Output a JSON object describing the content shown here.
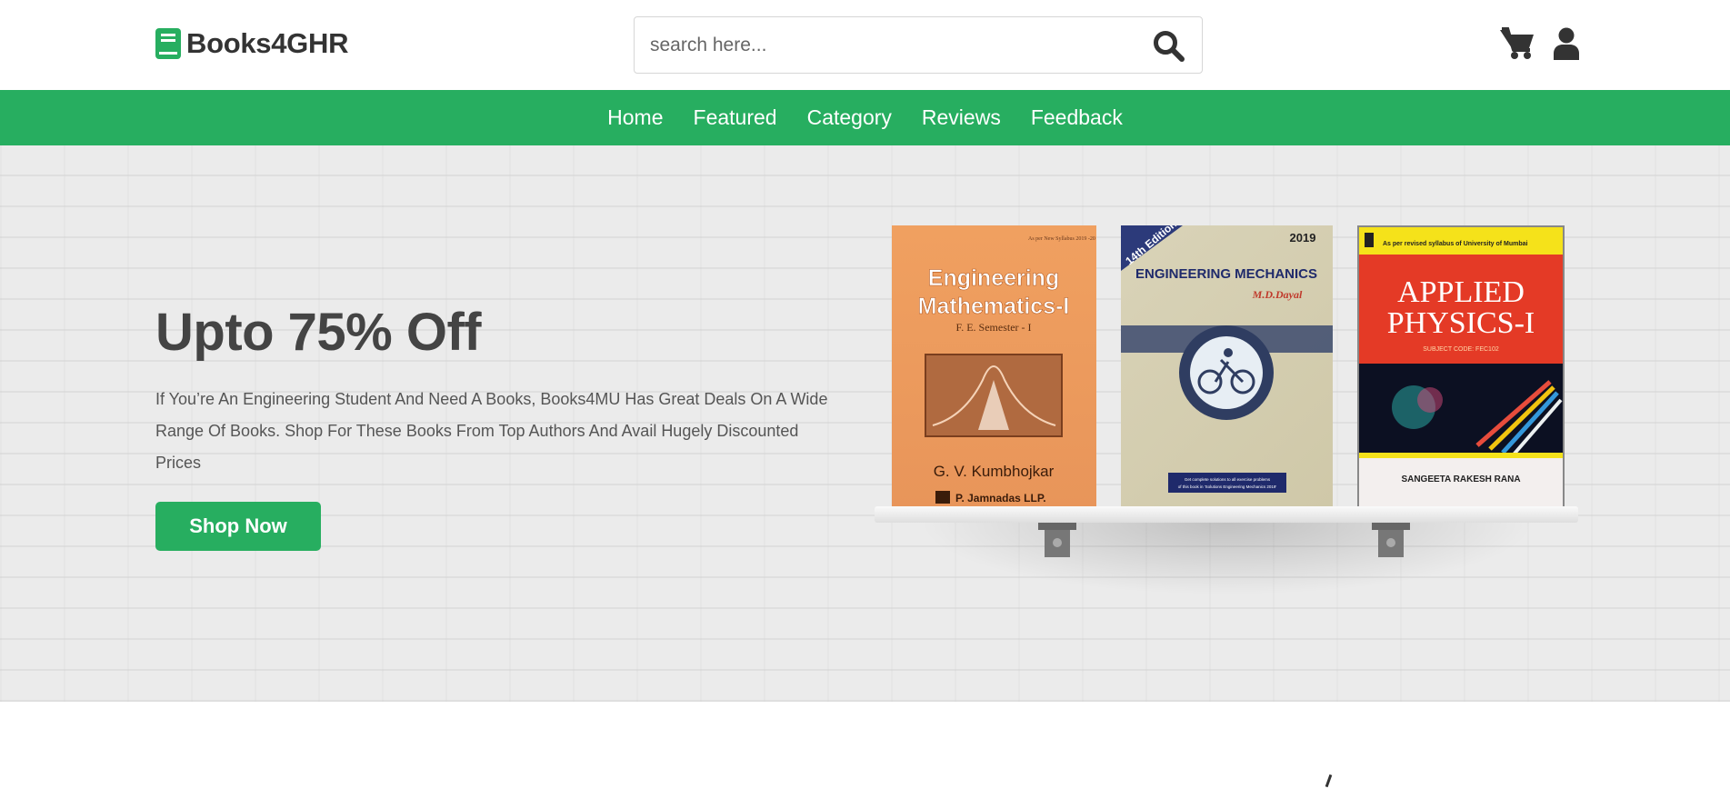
{
  "header": {
    "logo_text": "Books4GHR",
    "logo_icon": "book-icon",
    "search": {
      "placeholder": "search here...",
      "value": ""
    },
    "search_icon": "search-icon",
    "cart_icon": "shopping-cart-icon",
    "user_icon": "user-icon"
  },
  "nav": {
    "items": [
      {
        "label": "Home"
      },
      {
        "label": "Featured"
      },
      {
        "label": "Category"
      },
      {
        "label": "Reviews"
      },
      {
        "label": "Feedback"
      }
    ]
  },
  "hero": {
    "title": "Upto 75% Off",
    "description": "If You’re An Engineering Student And Need A Books, Books4MU Has Great Deals On A Wide Range Of Books. Shop For These Books From Top Authors And Avail Hugely Discounted Prices",
    "button_label": "Shop Now",
    "books": [
      {
        "title": "Engineering Mathematics-I",
        "subtitle": "F. E. Semester - I",
        "top_note": "As per New Syllabus 2019 -20",
        "author": "G. V. Kumbhojkar",
        "publisher": "P. Jamnadas LLP."
      },
      {
        "title": "ENGINEERING MECHANICS",
        "author": "M.D.Dayal",
        "edition": "14th Edition",
        "year": "2019",
        "note": "Get complete solutions to all exercise problems of this book in 'Solutions Engineering Mechanics 2019'"
      },
      {
        "title": "APPLIED PHYSICS-I",
        "top_note": "As per revised syllabus of University of Mumbai",
        "subject_code": "SUBJECT CODE: FEC102",
        "author": "SANGEETA RAKESH RANA"
      }
    ]
  },
  "colors": {
    "brand_green": "#27ae60",
    "text_dark": "#444444",
    "background": "#ebebeb"
  }
}
